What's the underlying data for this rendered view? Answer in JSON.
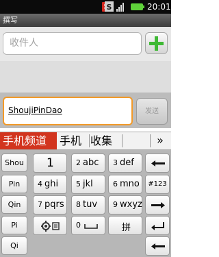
{
  "status_bar": {
    "time": "20:01",
    "s1": "S",
    "s2": "S"
  },
  "title": "撰写",
  "recipient": {
    "placeholder": "收件人"
  },
  "compose": {
    "text": "ShoujiPinDao",
    "send_label": "发送"
  },
  "candidates": {
    "items": [
      "手机频道",
      "手机",
      "收集"
    ],
    "more": "»"
  },
  "keyboard": {
    "pinyin_options": [
      "Shou",
      "Pin",
      "Qin",
      "Pi",
      "Qi"
    ],
    "rows": [
      [
        {
          "digit": "",
          "letters": "1"
        },
        {
          "digit": "2",
          "letters": "abc"
        },
        {
          "digit": "3",
          "letters": "def"
        }
      ],
      [
        {
          "digit": "4",
          "letters": "ghi"
        },
        {
          "digit": "5",
          "letters": "jkl"
        },
        {
          "digit": "6",
          "letters": "mno"
        }
      ],
      [
        {
          "digit": "7",
          "letters": "pqrs"
        },
        {
          "digit": "8",
          "letters": "tuv"
        },
        {
          "digit": "9",
          "letters": "wxyz"
        }
      ],
      [
        {
          "digit": "",
          "letters": ""
        },
        {
          "digit": "0",
          "letters": ""
        },
        {
          "digit": "",
          "letters": "拼"
        }
      ]
    ],
    "side_keys": {
      "symbol_mode": "#123"
    }
  }
}
